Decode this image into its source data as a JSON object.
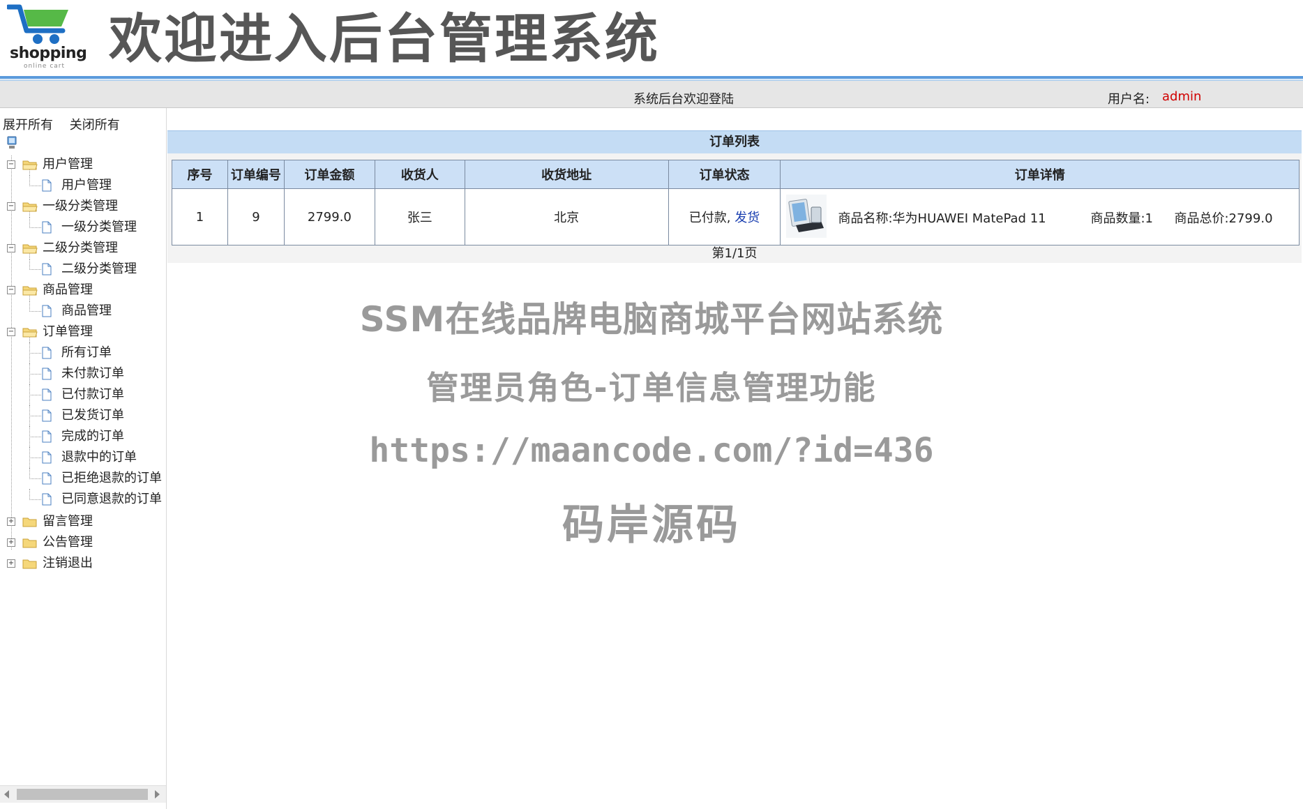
{
  "header": {
    "logo_brand": "shopping",
    "logo_tagline": "online cart",
    "banner_title": "欢迎进入后台管理系统"
  },
  "status_bar": {
    "welcome": "系统后台欢迎登陆",
    "user_label": "用户名:",
    "username": "admin"
  },
  "sidebar": {
    "expand_all": "展开所有",
    "collapse_all": "关闭所有",
    "groups": [
      {
        "label": "用户管理",
        "toggle": "−",
        "children": [
          "用户管理"
        ]
      },
      {
        "label": "一级分类管理",
        "toggle": "−",
        "children": [
          "一级分类管理"
        ]
      },
      {
        "label": "二级分类管理",
        "toggle": "−",
        "children": [
          "二级分类管理"
        ]
      },
      {
        "label": "商品管理",
        "toggle": "−",
        "children": [
          "商品管理"
        ]
      },
      {
        "label": "订单管理",
        "toggle": "−",
        "children": [
          "所有订单",
          "未付款订单",
          "已付款订单",
          "已发货订单",
          "完成的订单",
          "退款中的订单",
          "已拒绝退款的订单",
          "已同意退款的订单"
        ]
      },
      {
        "label": "留言管理",
        "toggle": "+",
        "children": []
      },
      {
        "label": "公告管理",
        "toggle": "+",
        "children": []
      },
      {
        "label": "注销退出",
        "toggle": "+",
        "children": []
      }
    ]
  },
  "orders": {
    "title": "订单列表",
    "columns": [
      "序号",
      "订单编号",
      "订单金额",
      "收货人",
      "收货地址",
      "订单状态",
      "订单详情"
    ],
    "rows": [
      {
        "index": "1",
        "order_no": "9",
        "amount": "2799.0",
        "receiver": "张三",
        "address": "北京",
        "status": "已付款,",
        "action": "发货",
        "detail_name": "商品名称:华为HUAWEI MatePad 11",
        "detail_qty": "商品数量:1",
        "detail_total": "商品总价:2799.0"
      }
    ],
    "pager": "第1/1页"
  },
  "watermark": {
    "line1": "SSM在线品牌电脑商城平台网站系统",
    "line2": "管理员角色-订单信息管理功能",
    "line3": "https://maancode.com/?id=436",
    "line4": "码岸源码"
  },
  "colors": {
    "header_line": "#5b9bdc",
    "panel_title_bg": "#c4dcf4",
    "username": "#d00000",
    "link": "#1a3fb0"
  }
}
